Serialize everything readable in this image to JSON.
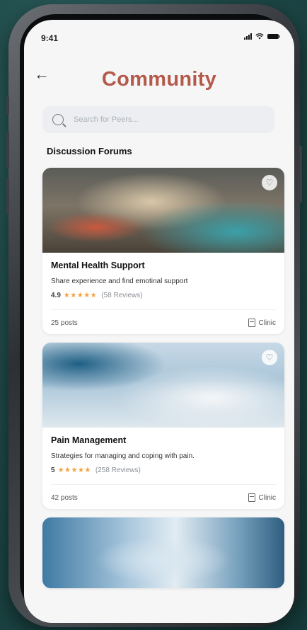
{
  "status": {
    "time": "9:41"
  },
  "header": {
    "title": "Community"
  },
  "search": {
    "placeholder": "Search for Peers..."
  },
  "section": {
    "title": "Discussion Forums"
  },
  "forums": [
    {
      "title": "Mental Health Support",
      "description": "Share experience and find emotinal support",
      "rating": "4.9",
      "stars": "★★★★★",
      "reviews": "(58 Reviews)",
      "posts": "25 posts",
      "tag": "Clinic",
      "image": "hospital-room-warm"
    },
    {
      "title": "Pain Management",
      "description": "Strategies for managing and coping with pain.",
      "rating": "5",
      "stars": "★★★★★",
      "reviews": "(258 Reviews)",
      "posts": "42 posts",
      "tag": "Clinic",
      "image": "hospital-ward-bright"
    },
    {
      "image": "hospital-corridor"
    }
  ],
  "icons": {
    "back": "arrow-left",
    "search": "magnifier",
    "favorite": "heart",
    "clinic": "building"
  },
  "colors": {
    "title": "#b55a4b",
    "stars": "#f2a23a",
    "background": "#1f4a49"
  }
}
